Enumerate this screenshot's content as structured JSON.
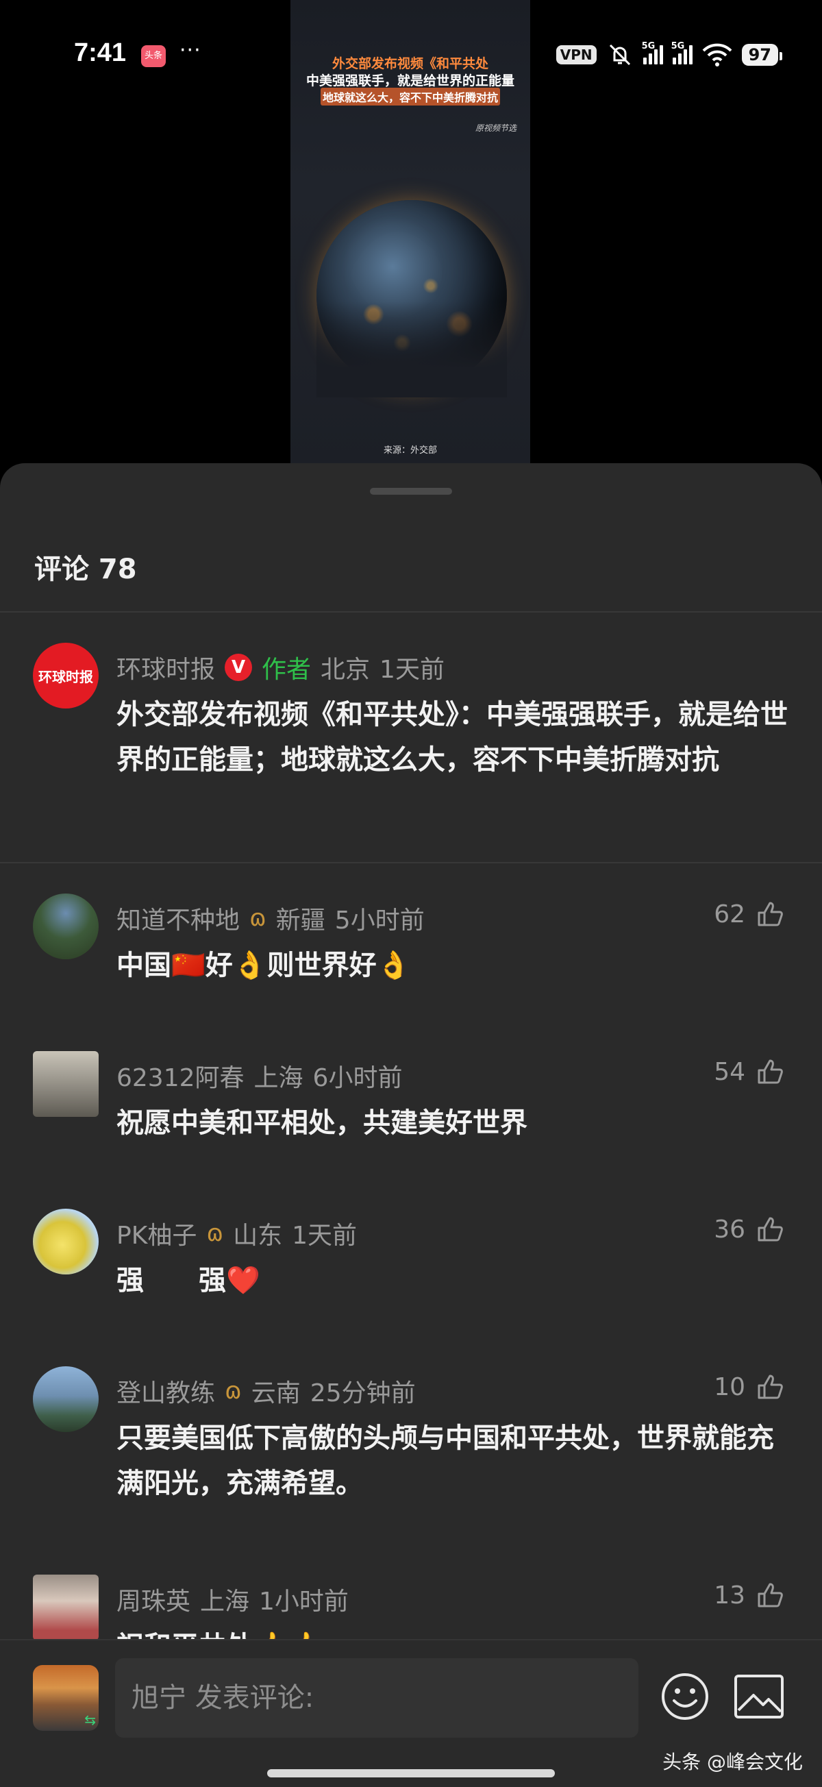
{
  "status_bar": {
    "time": "7:41",
    "app_badge": "头条",
    "more": "···",
    "vpn": "VPN",
    "network_1": "5G",
    "network_2": "5G",
    "battery": "97"
  },
  "video": {
    "caption_line1": "外交部发布视频《和平共处",
    "caption_line2": "中美强强联手，就是给世界的正能量",
    "caption_line3": "地球就这么大，容不下中美折腾对抗",
    "tag": "原视频节选",
    "source": "来源：外交部"
  },
  "comments_header": {
    "title": "评论 78"
  },
  "comments": [
    {
      "name": "环球时报",
      "verified": "V",
      "author_tag": "作者",
      "location": "北京",
      "time": "1天前",
      "text": "外交部发布视频《和平共处》：中美强强联手，就是给世界的正能量；地球就这么大，容不下中美折腾对抗",
      "avatar_text": "环球时报",
      "likes": ""
    },
    {
      "name": "知道不种地",
      "vip": "ɷ",
      "location": "新疆",
      "time": "5小时前",
      "text": "中国🇨🇳好👌则世界好👌",
      "likes": "62"
    },
    {
      "name": "62312阿春",
      "location": "上海",
      "time": "6小时前",
      "text": "祝愿中美和平相处，共建美好世界",
      "likes": "54"
    },
    {
      "name": "PK柚子",
      "vip": "ɷ",
      "location": "山东",
      "time": "1天前",
      "text": "强　　强❤️",
      "likes": "36"
    },
    {
      "name": "登山教练",
      "vip": "ɷ",
      "location": "云南",
      "time": "25分钟前",
      "text": "只要美国低下高傲的头颅与中国和平共处，世界就能充满阳光，充满希望。",
      "likes": "10"
    },
    {
      "name": "周珠英",
      "location": "上海",
      "time": "1小时前",
      "text": "祝和平共处👍👍",
      "likes": "13"
    }
  ],
  "input_bar": {
    "placeholder": "旭宁 发表评论:",
    "watermark": "头条 @峰会文化"
  },
  "colors": {
    "sheet_bg": "#2a2a2a",
    "author_green": "#2fbf4a",
    "verified_red": "#e6202a",
    "vip_gold": "#c8953a"
  }
}
